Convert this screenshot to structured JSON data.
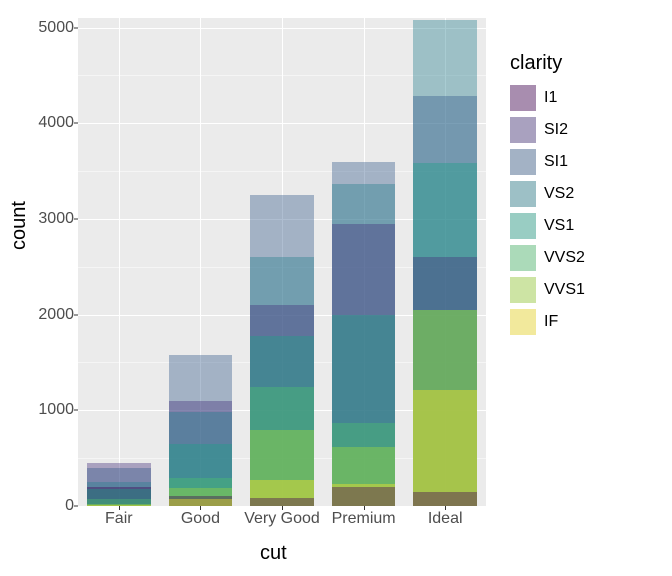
{
  "chart_data": {
    "type": "bar",
    "stacking": "identity_overlay",
    "alpha": 0.4,
    "xlabel": "cut",
    "ylabel": "count",
    "ylim": [
      0,
      5100
    ],
    "y_ticks": [
      0,
      1000,
      2000,
      3000,
      4000,
      5000
    ],
    "categories": [
      "Fair",
      "Good",
      "Very Good",
      "Premium",
      "Ideal"
    ],
    "legend_title": "clarity",
    "series": [
      {
        "name": "I1",
        "color": "#440154",
        "values": [
          200,
          100,
          80,
          200,
          150
        ]
      },
      {
        "name": "SI2",
        "color": "#46327E",
        "values": [
          450,
          1100,
          2100,
          2950,
          2600
        ]
      },
      {
        "name": "SI1",
        "color": "#365C8D",
        "values": [
          400,
          1580,
          3250,
          3600,
          4280
        ]
      },
      {
        "name": "VS2",
        "color": "#277F8E",
        "values": [
          250,
          980,
          2600,
          3370,
          5080
        ]
      },
      {
        "name": "VS1",
        "color": "#1FA187",
        "values": [
          180,
          650,
          1780,
          2000,
          3590
        ]
      },
      {
        "name": "VVS2",
        "color": "#4AC16D",
        "values": [
          70,
          290,
          1240,
          870,
          2050
        ]
      },
      {
        "name": "VVS1",
        "color": "#9FDA3A",
        "values": [
          20,
          190,
          790,
          620,
          2050
        ]
      },
      {
        "name": "IF",
        "color": "#FDE725",
        "values": [
          10,
          70,
          270,
          230,
          1210
        ]
      }
    ],
    "legend_order": [
      "I1",
      "SI2",
      "SI1",
      "VS2",
      "VS1",
      "VVS2",
      "VVS1",
      "IF"
    ]
  }
}
